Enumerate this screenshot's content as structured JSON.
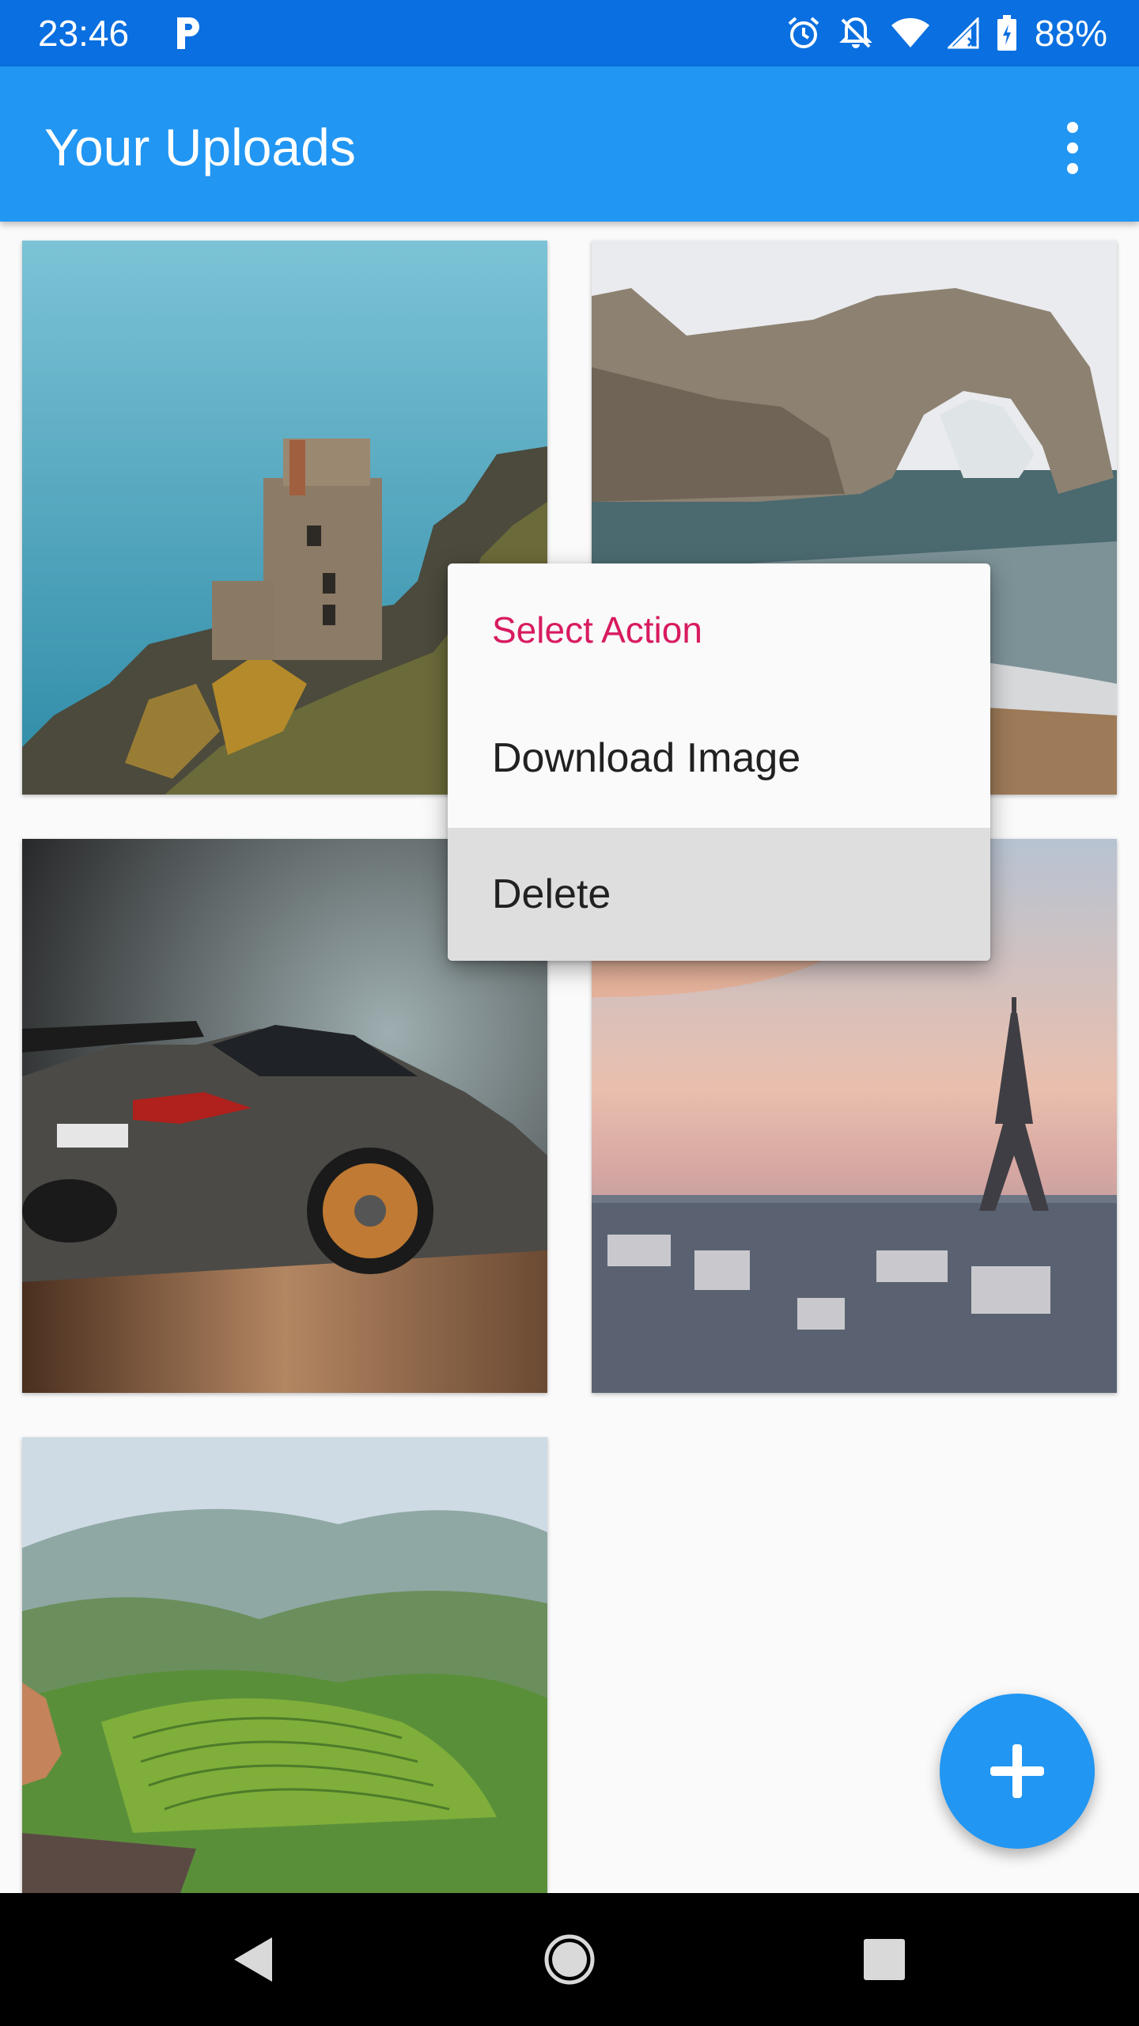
{
  "status_bar": {
    "time": "23:46",
    "battery_percent": "88%",
    "icons": [
      "p-notification-icon",
      "alarm-icon",
      "notifications-off-icon",
      "wifi-icon",
      "cell-signal-icon",
      "battery-charging-icon"
    ]
  },
  "app_bar": {
    "title": "Your Uploads",
    "overflow_icon": "more-vert-icon"
  },
  "gallery": {
    "images": [
      {
        "subject": "cliff-ruin"
      },
      {
        "subject": "sea-arch"
      },
      {
        "subject": "sports-car"
      },
      {
        "subject": "eiffel-tower-city"
      },
      {
        "subject": "rice-terraces"
      }
    ]
  },
  "context_menu": {
    "title": "Select Action",
    "items": [
      {
        "label": "Download Image"
      },
      {
        "label": "Delete",
        "highlighted": true
      }
    ]
  },
  "fab": {
    "icon": "add-icon"
  },
  "nav_bar": {
    "icons": [
      "back-icon",
      "home-icon",
      "recents-icon"
    ]
  },
  "colors": {
    "status_bar": "#0a6fe0",
    "app_bar": "#2196f3",
    "menu_title": "#d81b60",
    "fab": "#2196f3",
    "menu_highlight": "#dedede"
  }
}
